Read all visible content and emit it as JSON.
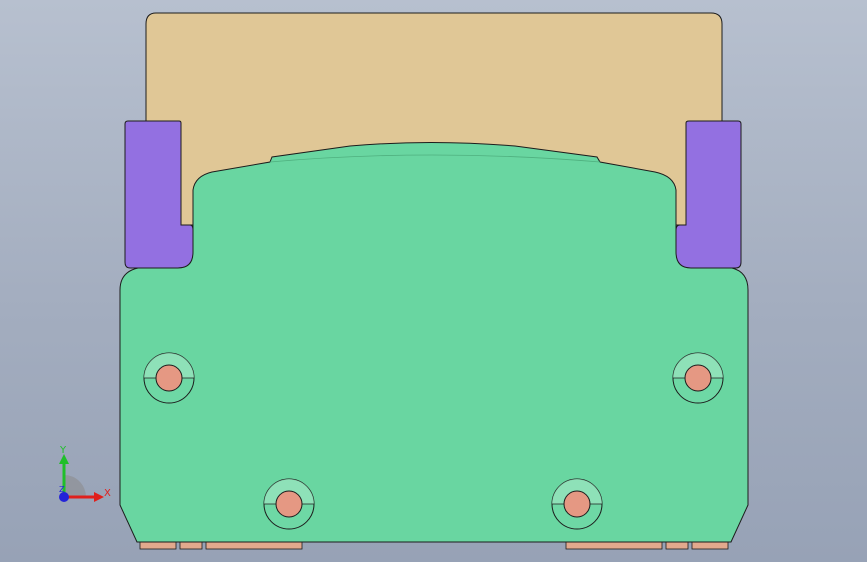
{
  "viewport": {
    "background": "#a9b3c4"
  },
  "parts": [
    {
      "id": "base-block",
      "color": "#69d6a1"
    },
    {
      "id": "top-block",
      "color": "#e0c796"
    },
    {
      "id": "side-clamp-left",
      "color": "#9370e1"
    },
    {
      "id": "side-clamp-right",
      "color": "#9370e1"
    },
    {
      "id": "bottom-pads",
      "color": "#e2a98d"
    }
  ],
  "holes": {
    "count": 4,
    "boss_color": "#e59883",
    "counterbore_color": "#6ed8a5"
  },
  "triad": {
    "x_label": "X",
    "y_label": "Y",
    "z_label": "Z",
    "x_color": "#e0201c",
    "y_color": "#1fbf2a",
    "z_color": "#2323d8"
  }
}
